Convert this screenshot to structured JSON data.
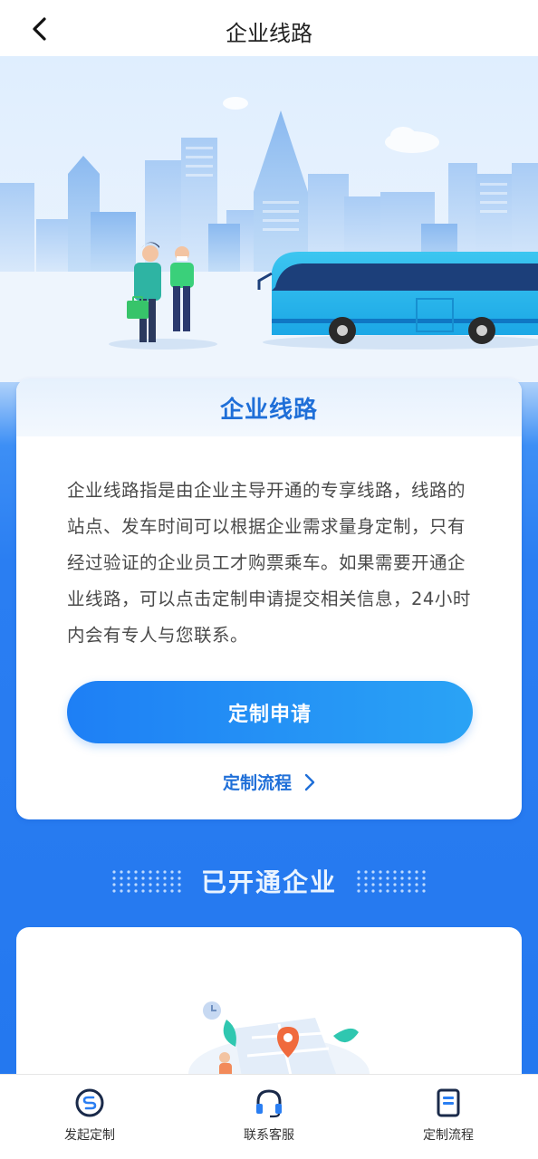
{
  "nav": {
    "title": "企业线路",
    "back_icon": "back-arrow-icon"
  },
  "intro": {
    "title": "企业线路",
    "description": "企业线路指是由企业主导开通的专享线路，线路的站点、发车时间可以根据企业需求量身定制，只有经过验证的企业员工才购票乘车。如果需要开通企业线路，可以点击定制申请提交相关信息，24小时内会有专人与您联系。",
    "apply_button": "定制申请",
    "process_link": "定制流程"
  },
  "companies": {
    "title": "已开通企业"
  },
  "tabbar": {
    "items": [
      {
        "label": "发起定制",
        "icon": "custom-route-icon"
      },
      {
        "label": "联系客服",
        "icon": "headset-icon"
      },
      {
        "label": "定制流程",
        "icon": "document-icon"
      }
    ]
  },
  "colors": {
    "primary": "#1f6fd8",
    "button_start": "#1e7ff5",
    "button_end": "#2aa3f5",
    "background_blue": "#2478ef"
  }
}
